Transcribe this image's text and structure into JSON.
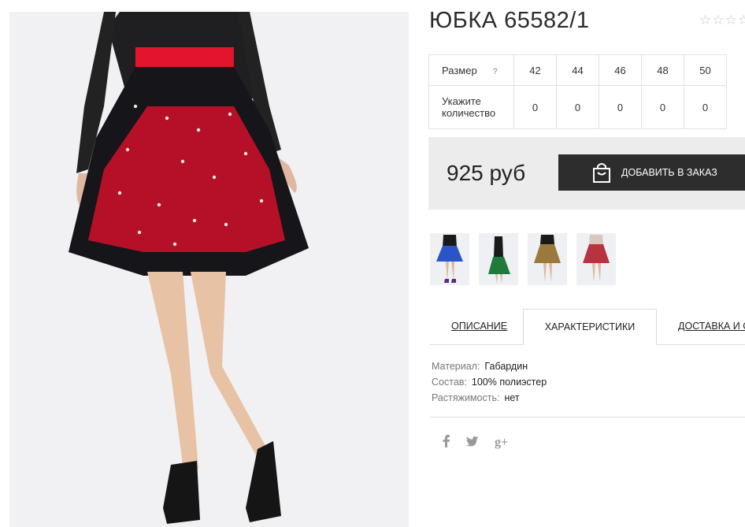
{
  "product": {
    "title": "ЮБКА 65582/1",
    "rating_stars": "☆☆☆☆☆"
  },
  "size_table": {
    "size_label": "Размер",
    "help": "?",
    "qty_label": "Укажите количество",
    "sizes": [
      "42",
      "44",
      "46",
      "48",
      "50"
    ],
    "quantities": [
      "0",
      "0",
      "0",
      "0",
      "0"
    ]
  },
  "buy": {
    "price": "925 руб",
    "button_label": "ДОБАВИТЬ В ЗАКАЗ"
  },
  "color_variants": [
    {
      "color": "#2a55c8",
      "top": "#1a1a1a"
    },
    {
      "color": "#1f7a3c",
      "top": "#1a1a1a"
    },
    {
      "color": "#9a7a3a",
      "top": "#1a1a1a"
    },
    {
      "color": "#b8333f",
      "top": "#d9c7c0"
    }
  ],
  "tabs": {
    "description": "ОПИСАНИЕ",
    "characteristics": "ХАРАКТЕРИСТИКИ",
    "delivery": "ДОСТАВКА И О"
  },
  "specs": {
    "material_key": "Материал:",
    "material_val": "Габардин",
    "composition_key": "Состав:",
    "composition_val": "100% полиэстер",
    "stretch_key": "Растяжимость:",
    "stretch_val": "нет"
  },
  "social": {
    "facebook": "f",
    "twitter": "🐦",
    "gplus": "g+"
  },
  "colors": {
    "accent_dark": "#2d2d2d",
    "skirt_red": "#d6152b",
    "panel_bg": "#ececec"
  }
}
